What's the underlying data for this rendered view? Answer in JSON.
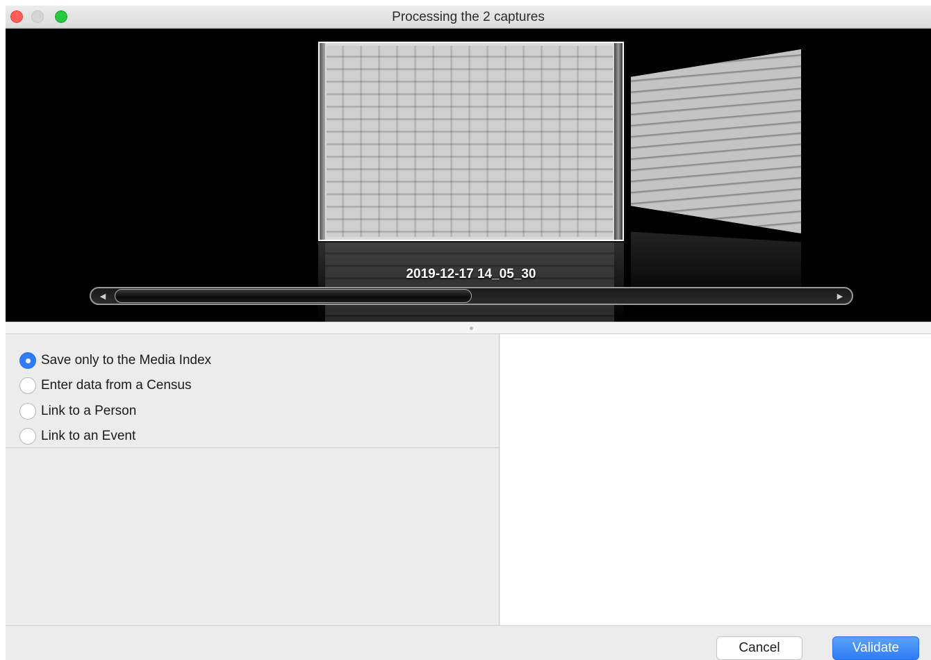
{
  "window": {
    "title": "Processing the 2 captures"
  },
  "preview": {
    "caption": "2019-12-17 14_05_30",
    "scroll_position": 0.43
  },
  "options": {
    "items": [
      {
        "label": "Save only to the Media Index",
        "checked": true
      },
      {
        "label": "Enter data from a Census",
        "checked": false
      },
      {
        "label": "Link to a Person",
        "checked": false
      },
      {
        "label": "Link to an Event",
        "checked": false
      }
    ]
  },
  "buttons": {
    "cancel": "Cancel",
    "validate": "Validate"
  },
  "colors": {
    "accent": "#2f7cf6",
    "close": "#fe5f57",
    "maximize": "#28c840"
  }
}
